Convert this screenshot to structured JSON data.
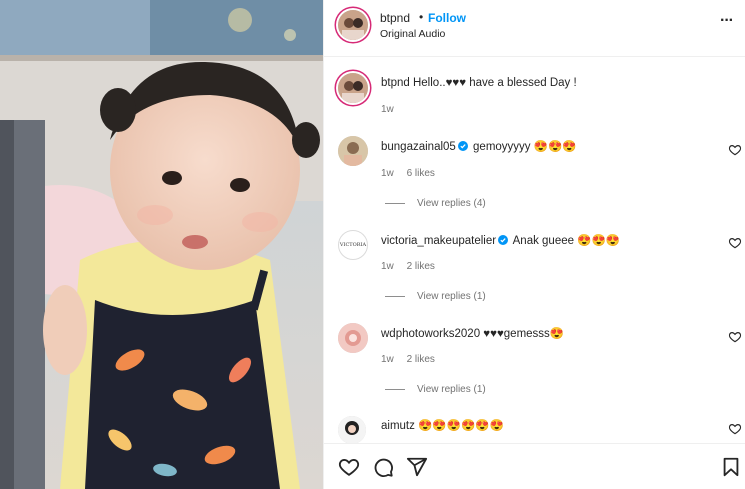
{
  "post": {
    "username": "btpnd",
    "separator": "•",
    "follow_label": "Follow",
    "audio_label": "Original Audio",
    "more_label": "···"
  },
  "caption": {
    "username": "btpnd",
    "text": "Hello..♥♥♥ have a blessed Day !",
    "time": "1w"
  },
  "comments": [
    {
      "username": "bungazainal05",
      "verified": true,
      "text": "gemoyyyyy 😍😍😍",
      "time": "1w",
      "likes": "6 likes",
      "replies": "View replies (4)"
    },
    {
      "username": "victoria_makeupatelier",
      "verified": true,
      "text": "Anak gueee 😍😍😍",
      "time": "1w",
      "likes": "2 likes",
      "replies": "View replies (1)",
      "avatar_text": "VICTORIA"
    },
    {
      "username": "wdphotoworks2020",
      "verified": false,
      "text": "♥♥♥gemesss😍",
      "time": "1w",
      "likes": "2 likes",
      "replies": "View replies (1)"
    },
    {
      "username": "aimutz",
      "verified": false,
      "text": "😍😍😍😍😍😍",
      "time": "",
      "likes": "",
      "replies": ""
    }
  ],
  "icons": {
    "like": "heart-outline-icon",
    "comment": "comment-icon",
    "share": "share-icon",
    "save": "bookmark-icon",
    "more": "more-icon",
    "verified": "verified-badge-icon"
  },
  "colors": {
    "accent": "#0095f6",
    "muted": "#737373",
    "text": "#262626"
  }
}
